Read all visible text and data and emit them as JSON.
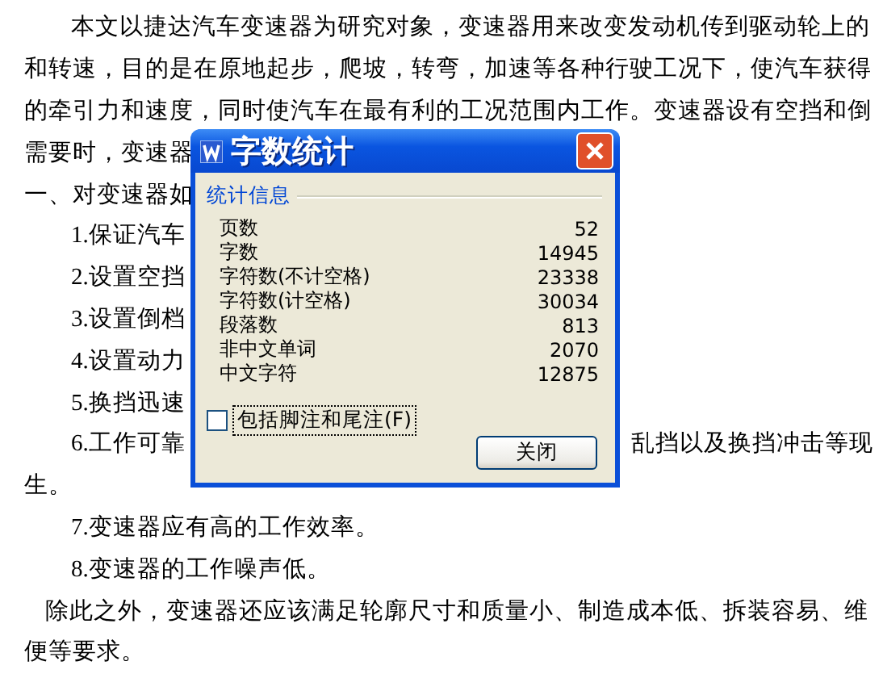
{
  "document": {
    "lines": [
      {
        "kind": "para",
        "text": "本文以捷达汽车变速器为研究对象，变速器用来改变发动机传到驱动轮上的"
      },
      {
        "kind": "body",
        "text": "和转速，目的是在原地起步，爬坡，转弯，加速等各种行驶工况下，使汽车获得"
      },
      {
        "kind": "body",
        "text": "的牵引力和速度，同时使汽车在最有利的工况范围内工作。变速器设有空挡和倒"
      },
      {
        "kind": "body",
        "text": "需要时，变速器"
      },
      {
        "kind": "body",
        "text": "一、对变速器如"
      },
      {
        "kind": "item",
        "text": "1.保证汽车"
      },
      {
        "kind": "item",
        "text": "2.设置空挡"
      },
      {
        "kind": "item",
        "text": "3.设置倒档"
      },
      {
        "kind": "item",
        "text": "4.设置动力"
      },
      {
        "kind": "item",
        "text": "5.换挡迅速"
      },
      {
        "kind": "item",
        "text": "6.工作可靠",
        "right": "乱挡以及换挡冲击等现"
      },
      {
        "kind": "body",
        "text": "生。"
      },
      {
        "kind": "item",
        "text": "7.变速器应有高的工作效率。"
      },
      {
        "kind": "item",
        "text": "8.变速器的工作噪声低。"
      },
      {
        "kind": "narrow",
        "text": "除此之外，变速器还应该满足轮廓尺寸和质量小、制造成本低、拆装容易、维"
      },
      {
        "kind": "body",
        "text": "便等要求。"
      }
    ]
  },
  "dialog": {
    "title": "字数统计",
    "group_label": "统计信息",
    "stats": [
      {
        "label": "页数",
        "value": "52"
      },
      {
        "label": "字数",
        "value": "14945"
      },
      {
        "label": "字符数(不计空格)",
        "value": "23338"
      },
      {
        "label": "字符数(计空格)",
        "value": "30034"
      },
      {
        "label": "段落数",
        "value": "813"
      },
      {
        "label": "非中文单词",
        "value": "2070"
      },
      {
        "label": "中文字符",
        "value": "12875"
      }
    ],
    "checkbox": {
      "label": "包括脚注和尾注(F)",
      "checked": false
    },
    "buttons": [
      "关闭"
    ]
  }
}
